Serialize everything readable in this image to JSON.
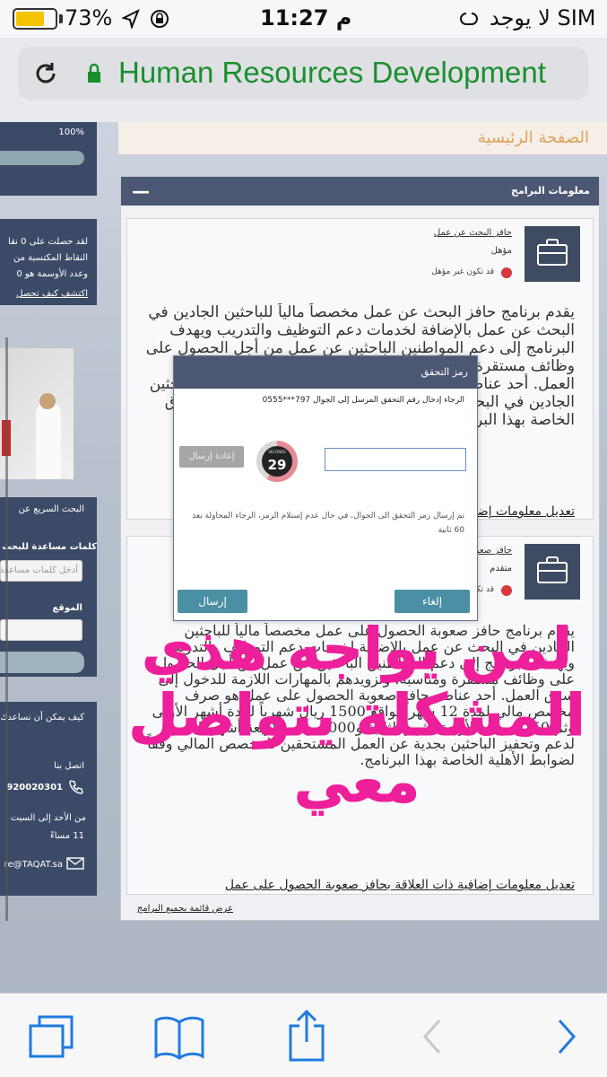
{
  "status_bar": {
    "battery_percent": "73%",
    "time": "11:27 م",
    "carrier": "لا يوجد SIM",
    "battery_level": 0.73
  },
  "browser": {
    "url_title": "Human Resources Development"
  },
  "sidebar": {
    "progress_percent": "100%",
    "points_text_1": "لقد حصلت على 0 نقا",
    "points_text_2": "النقاط المكتسبة من",
    "points_text_3": "وعدد الأوسمة هو 0",
    "discover_link": "اكتشف كيف تحصل",
    "quick_search_title": "البحث السريع عن",
    "keywords_label": "كلمات مساعدة للبحث",
    "keywords_placeholder": "أدخل كلمات مساعدة",
    "location_label": "الموقع",
    "help_title": "كيف يمكن أن نساعدك",
    "contact_label": "اتصل بنا",
    "phone": "920020301",
    "hours_1": "من الأحد إلى السبت",
    "hours_2": "11 مساءً",
    "email": "re@TAQAT.sa"
  },
  "home_link": "الصفحة الرئيسية",
  "programs": {
    "title": "معلومات البرامج",
    "collapse": "—",
    "card1": {
      "name": "حافز البحث عن عمل",
      "status": "مؤهل",
      "warning": "قد تكون غير مؤهل",
      "body": "يقدم برنامج حافز البحث عن عمل مخصصاً مالياً للباحثين الجادين في البحث عن عمل بالإضافة لخدمات دعم التوظيف والتدريب ويهدف البرنامج إلى دعم المواطنين الباحثين عن عمل من أجل الحصول على وظائف مستقرة وتزويدهم بالمهارات اللازمة للدخول إلى سوق العمل. أحد عناصر البرنامج هو صرف مخصص بشكل شهري للباحثين الجادين في البحث عن العمل المستحقين وفقاً لضوابط الاستحقاق الخاصة بهذا البرنامج.",
      "link": "تعديل معلومات إضافية ذات العلاقة بحافز البحث عن عمل"
    },
    "card2": {
      "name": "حافز صعوبة الحصول على عمل",
      "status": "متقدم",
      "warning": "قد تكون غير مؤهل",
      "body": "يقدم برنامج حافز صعوبة الحصول على عمل مخصصاً مالياً للباحثين الجادين في البحث عن عمل بالإضافة لخدمات دعم التوظيف والتدريب ويهدف البرنامج إلى دعم المواطنين الباحثين عن عمل من أجل الحصول على وظائف مستقرة ومناسبة، وتزويدهم بالمهارات اللازمة للدخول إلى سوق العمل. أحد عناصر حافز صعوبة الحصول على عمل هو صرف مخصص مالي لمدة 12 شهراً بواقع 1500 ريال شهرياً لمدة أشهر الأولى وثم 1250 ريال للأربعة أشهر الثانية و1000 ريال للأربعة أشهر الأخيرة لدعم وتحفيز الباحثين بجدية عن العمل المستحقين للمخصص المالي وفقاً لضوابط الأهلية الخاصة بهذا البرنامج.",
      "link": "تعديل معلومات إضافية ذات العلاقة بحافز صعوبة الحصول على عمل"
    },
    "view_all": "عرض قائمة بجميع البرامج"
  },
  "modal": {
    "title": "رمز التحقق",
    "instruction": "الرجاء إدخال رقم التحقق المرسل إلى الجوال 797***0555",
    "timer_label": "SECONDS",
    "timer_value": "29",
    "resend": "إعادة إرسال",
    "note": "تم إرسال رمز التحقق الى الجوال، في حال عدم إستلام الرمز، الرجاء المحاولة بعد 60 ثانية",
    "send": "إرسال",
    "cancel": "إلغاء",
    "code_value": ""
  },
  "overlay_caption": {
    "line1": "لمن يواجه هذي",
    "line2": "المشكلة يتواصل",
    "line3": "معي"
  },
  "colors": {
    "header": "#4c5774",
    "accent": "#4a8fa3",
    "caption": "#ee1f9a",
    "url_green": "#1a8f2f"
  }
}
